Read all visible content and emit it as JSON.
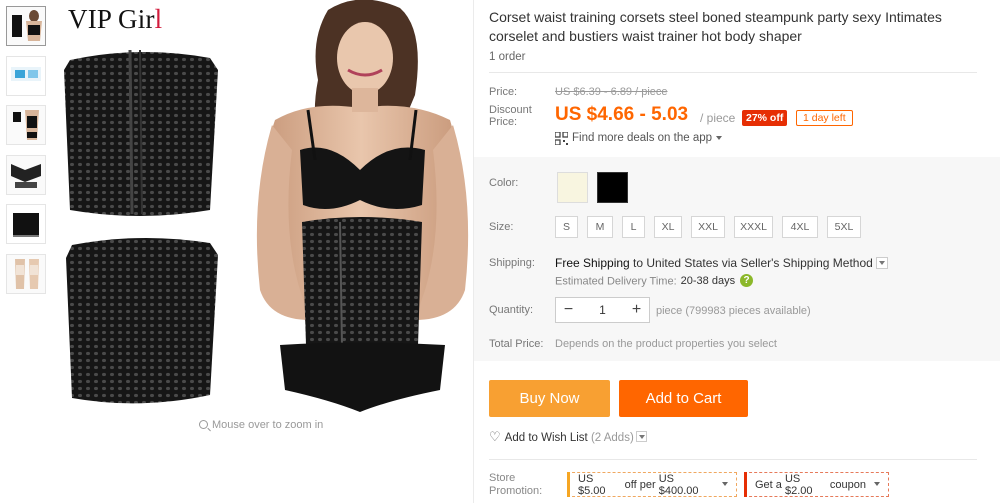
{
  "brand": {
    "name_prefix": "VIP Gir",
    "name_suffix": "l"
  },
  "gallery": {
    "zoom_hint": "Mouse over to zoom in",
    "thumbnail_count": 6
  },
  "product": {
    "title": "Corset waist training corsets steel boned steampunk party sexy Intimates corselet and bustiers waist trainer hot body shaper",
    "orders": "1 order"
  },
  "pricing": {
    "price_label": "Price:",
    "old_price": "US $6.39 - 6.89 / piece",
    "discount_label_line1": "Discount",
    "discount_label_line2": "Price:",
    "price": "US $4.66 - 5.03",
    "per": "/ piece",
    "off_badge": "27% off",
    "days_left": "1 day left",
    "app_deals": "Find more deals on the app"
  },
  "options": {
    "color_label": "Color:",
    "colors": [
      "#f8f5e0",
      "#000000"
    ],
    "size_label": "Size:",
    "sizes": [
      "S",
      "M",
      "L",
      "XL",
      "XXL",
      "XXXL",
      "4XL",
      "5XL"
    ]
  },
  "shipping": {
    "label": "Shipping:",
    "free": "Free Shipping",
    "to_text": " to United States via Seller's Shipping Method",
    "estimated_label": "Estimated Delivery Time:",
    "days": "20-38 days"
  },
  "quantity": {
    "label": "Quantity:",
    "value": "1",
    "minus": "−",
    "plus": "+",
    "available": "piece (799983 pieces available)"
  },
  "total": {
    "label": "Total Price:",
    "value": "Depends on the product properties you select"
  },
  "actions": {
    "buy_now": "Buy Now",
    "add_to_cart": "Add to Cart",
    "wish_list": "Add to Wish List",
    "wish_count": "(2 Adds)"
  },
  "promotion": {
    "label_line1": "Store",
    "label_line2": "Promotion:",
    "coupon1_amount": "US $5.00",
    "coupon1_mid": " off per ",
    "coupon1_threshold": "US $400.00",
    "coupon2_prefix": "Get a ",
    "coupon2_amount": "US $2.00",
    "coupon2_suffix": " coupon"
  },
  "colors": {
    "accent": "#ff6600",
    "buy_now": "#f8a032",
    "add_to_cart": "#ff6600",
    "badge": "#e62e04"
  }
}
